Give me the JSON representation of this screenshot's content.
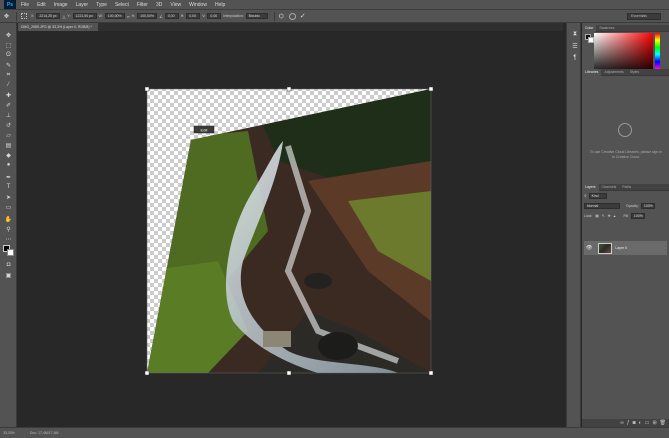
{
  "app": {
    "logo": "Ps"
  },
  "menu": [
    "File",
    "Edit",
    "Image",
    "Layer",
    "Type",
    "Select",
    "Filter",
    "3D",
    "View",
    "Window",
    "Help"
  ],
  "options": {
    "x_label": "X:",
    "x_value": "2214,25 px",
    "y_label": "Y:",
    "y_value": "1221,50 px",
    "w_label": "W:",
    "w_value": "100,00%",
    "h_label": "H:",
    "h_value": "100,00%",
    "angle_value": "0,00",
    "hskew_label": "H:",
    "hskew_value": "0,00",
    "vskew_label": "V:",
    "vskew_value": "0,00",
    "interpolation_label": "Interpolation:",
    "interpolation_value": "Bicubic",
    "workspace": "Essentials"
  },
  "document": {
    "tab_title": "DMG_2989.JPG @ 33,3% (Layer 0, RGB/8) *",
    "tooltip": "Edit"
  },
  "status": {
    "zoom": "33,33%",
    "doc_info": "Doc: 17,4M/17,4M"
  },
  "panels": {
    "color_tabs": [
      "Color",
      "Swatches"
    ],
    "library_tabs": [
      "Libraries",
      "Adjustments",
      "Styles"
    ],
    "library_message": "To use Creative Cloud Libraries, please sign in to Creative Cloud.",
    "layers_tabs": [
      "Layers",
      "Channels",
      "Paths"
    ],
    "kind_label": "Kind",
    "blend_mode": "Normal",
    "opacity_label": "Opacity:",
    "opacity_value": "100%",
    "lock_label": "Lock:",
    "fill_label": "Fill:",
    "fill_value": "100%",
    "layer_name": "Layer 0"
  },
  "icons": {
    "tools": [
      "move-icon",
      "marquee-icon",
      "lasso-icon",
      "quick-select-icon",
      "crop-icon",
      "eyedropper-icon",
      "healing-icon",
      "brush-icon",
      "stamp-icon",
      "history-brush-icon",
      "eraser-icon",
      "gradient-icon",
      "blur-icon",
      "dodge-icon",
      "pen-icon",
      "type-icon",
      "path-select-icon",
      "shape-icon",
      "hand-icon",
      "zoom-icon"
    ]
  }
}
